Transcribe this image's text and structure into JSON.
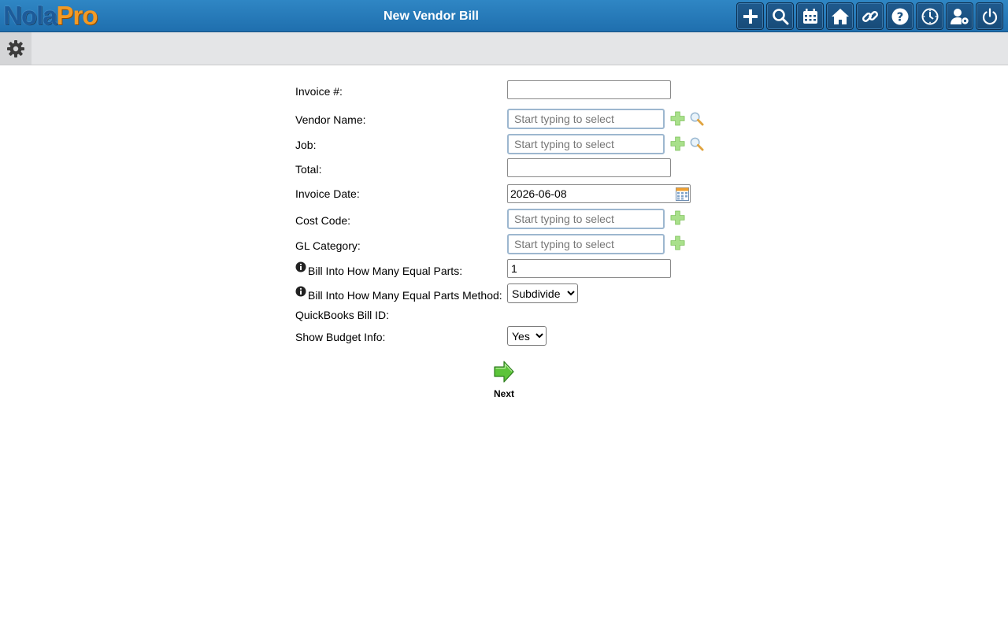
{
  "header": {
    "logo_part1": "Nola",
    "logo_part2": "Pro",
    "title": "New Vendor Bill",
    "toolbar_icons": [
      "add-icon",
      "search-icon",
      "calendar-icon",
      "home-icon",
      "link-icon",
      "help-icon",
      "history-clock-icon",
      "user-settings-icon",
      "power-icon"
    ]
  },
  "subbar": {
    "icon": "gear-icon"
  },
  "form": {
    "invoice_number": {
      "label": "Invoice #:",
      "value": ""
    },
    "vendor_name": {
      "label": "Vendor Name:",
      "placeholder": "Start typing to select"
    },
    "job": {
      "label": "Job:",
      "placeholder": "Start typing to select"
    },
    "total": {
      "label": "Total:",
      "value": ""
    },
    "invoice_date": {
      "label": "Invoice Date:",
      "value": "2026-06-08"
    },
    "cost_code": {
      "label": "Cost Code:",
      "placeholder": "Start typing to select"
    },
    "gl_category": {
      "label": "GL Category:",
      "placeholder": "Start typing to select"
    },
    "equal_parts": {
      "label": "Bill Into How Many Equal Parts:",
      "value": "1"
    },
    "equal_parts_method": {
      "label": "Bill Into How Many Equal Parts Method:",
      "selected": "Subdivide"
    },
    "quickbooks_bill_id": {
      "label": "QuickBooks Bill ID:"
    },
    "show_budget_info": {
      "label": "Show Budget Info:",
      "selected": "Yes"
    }
  },
  "next_button": {
    "label": "Next"
  },
  "colors": {
    "header_bg": "#2578b8",
    "toolbar_button": "#1b5283",
    "subbar_bg": "#e4e5e7",
    "add_green": "#8fd46a",
    "next_arrow_green": "#5cc43a"
  }
}
